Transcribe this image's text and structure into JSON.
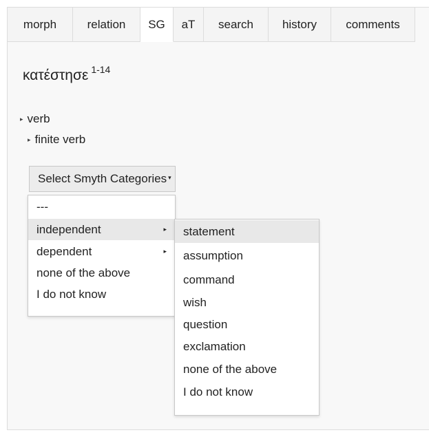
{
  "tabs": [
    {
      "label": "morph"
    },
    {
      "label": "relation"
    },
    {
      "label": "SG"
    },
    {
      "label": "aT"
    },
    {
      "label": "search"
    },
    {
      "label": "history"
    },
    {
      "label": "comments"
    }
  ],
  "word": {
    "text": "κατέστησε",
    "range": "1-14"
  },
  "tree": {
    "root": "verb",
    "child": "finite verb"
  },
  "select": {
    "label": "Select Smyth Categories"
  },
  "menu": {
    "items": [
      "---",
      "independent",
      "dependent",
      "none of the above",
      "I do not know"
    ]
  },
  "submenu": {
    "items": [
      "statement",
      "assumption",
      "command",
      "wish",
      "question",
      "exclamation",
      "none of the above",
      "I do not know"
    ]
  }
}
